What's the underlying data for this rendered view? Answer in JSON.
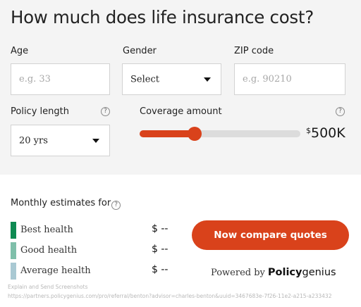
{
  "header": {
    "title": "How much does life insurance cost?"
  },
  "form": {
    "age": {
      "label": "Age",
      "placeholder": "e.g. 33"
    },
    "gender": {
      "label": "Gender",
      "value": "Select"
    },
    "zip": {
      "label": "ZIP code",
      "placeholder": "e.g. 90210"
    },
    "policy_length": {
      "label": "Policy length",
      "value": "20 yrs",
      "help_icon": "question-circle-icon"
    },
    "coverage": {
      "label": "Coverage amount",
      "currency": "$",
      "value": "500K",
      "slider_fraction": 0.34,
      "help_icon": "question-circle-icon"
    }
  },
  "estimates": {
    "label": "Monthly estimates for",
    "rows": [
      {
        "label": "Best health",
        "price": "$ --",
        "color": "#0e8a52"
      },
      {
        "label": "Good health",
        "price": "$ --",
        "color": "#7fbfaa"
      },
      {
        "label": "Average health",
        "price": "$ --",
        "color": "#a9c9d3"
      }
    ]
  },
  "cta": {
    "label": "Now compare quotes"
  },
  "powered_by": {
    "prefix": "Powered by",
    "brand_bold": "Policy",
    "brand_rest": "genius"
  },
  "footer": {
    "line1": "Explain and Send Screenshots",
    "line2": "https://partners.policygenius.com/pro/referral/benton?advisor=charles-benton&uuid=3467683e-7f26-11e2-a215-a233432"
  },
  "colors": {
    "accent": "#d9421b",
    "panel_bg": "#f4f4f4"
  }
}
